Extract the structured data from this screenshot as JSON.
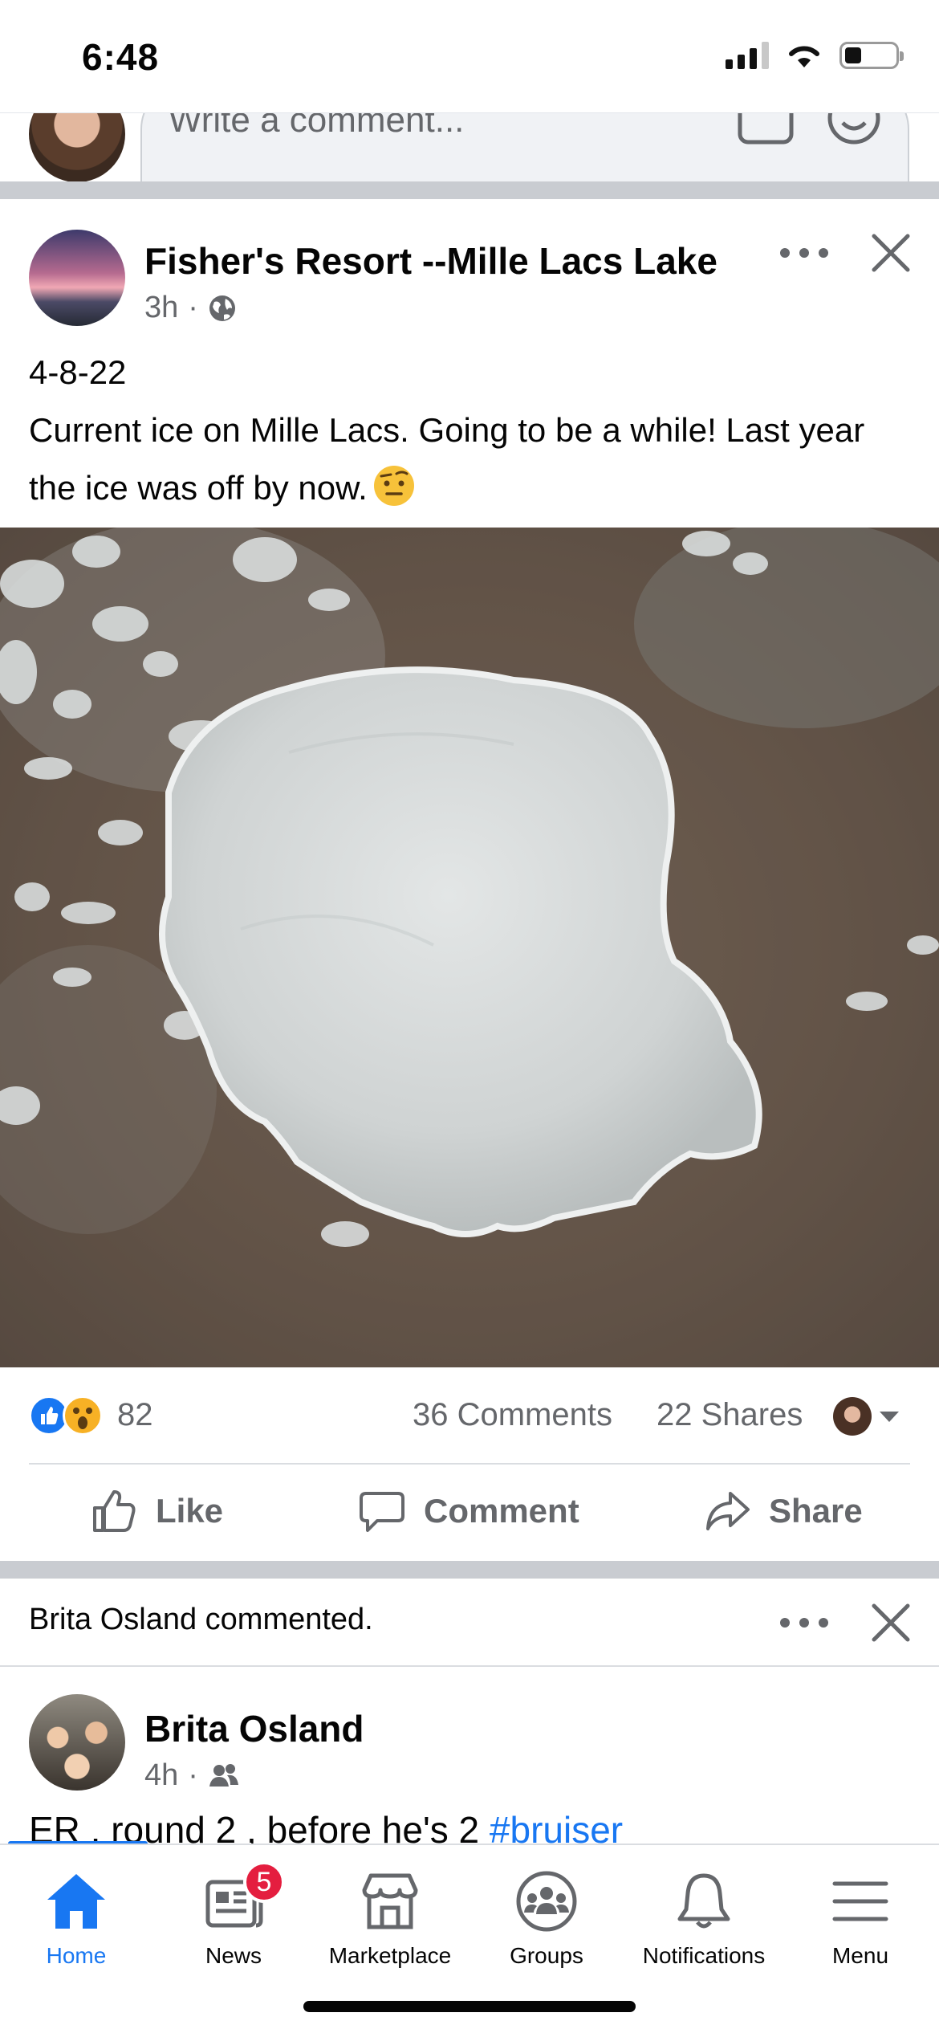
{
  "status_bar": {
    "time": "6:48",
    "battery_level": 0.34
  },
  "previous_post": {
    "comment_placeholder": "Write a comment..."
  },
  "post": {
    "author": "Fisher's Resort --Mille Lacs Lake",
    "time": "3h",
    "audience_icon": "globe-icon",
    "text_line1": "4-8-22",
    "text_line2": "Current ice on Mille Lacs. Going to be a while! Last year the ice was off by now.",
    "text_emoji": "face-with-raised-eyebrow-emoji",
    "reaction_count": "82",
    "comments_count": "36 Comments",
    "shares_count": "22 Shares",
    "actions": {
      "like": "Like",
      "comment": "Comment",
      "share": "Share"
    }
  },
  "notification": {
    "text": "Brita Osland commented."
  },
  "second_post": {
    "author": "Brita Osland",
    "time": "4h",
    "audience_icon": "friends-icon",
    "text": "ER , round 2 , before he's 2 ",
    "hashtag": "#bruiser"
  },
  "tab_bar": {
    "home": "Home",
    "news": "News",
    "news_badge": "5",
    "marketplace": "Marketplace",
    "groups": "Groups",
    "notifications": "Notifications",
    "menu": "Menu"
  },
  "colors": {
    "accent": "#1877f2",
    "badge": "#e41e3f",
    "secondary_text": "#65676b",
    "separator": "#c9ccd1"
  }
}
